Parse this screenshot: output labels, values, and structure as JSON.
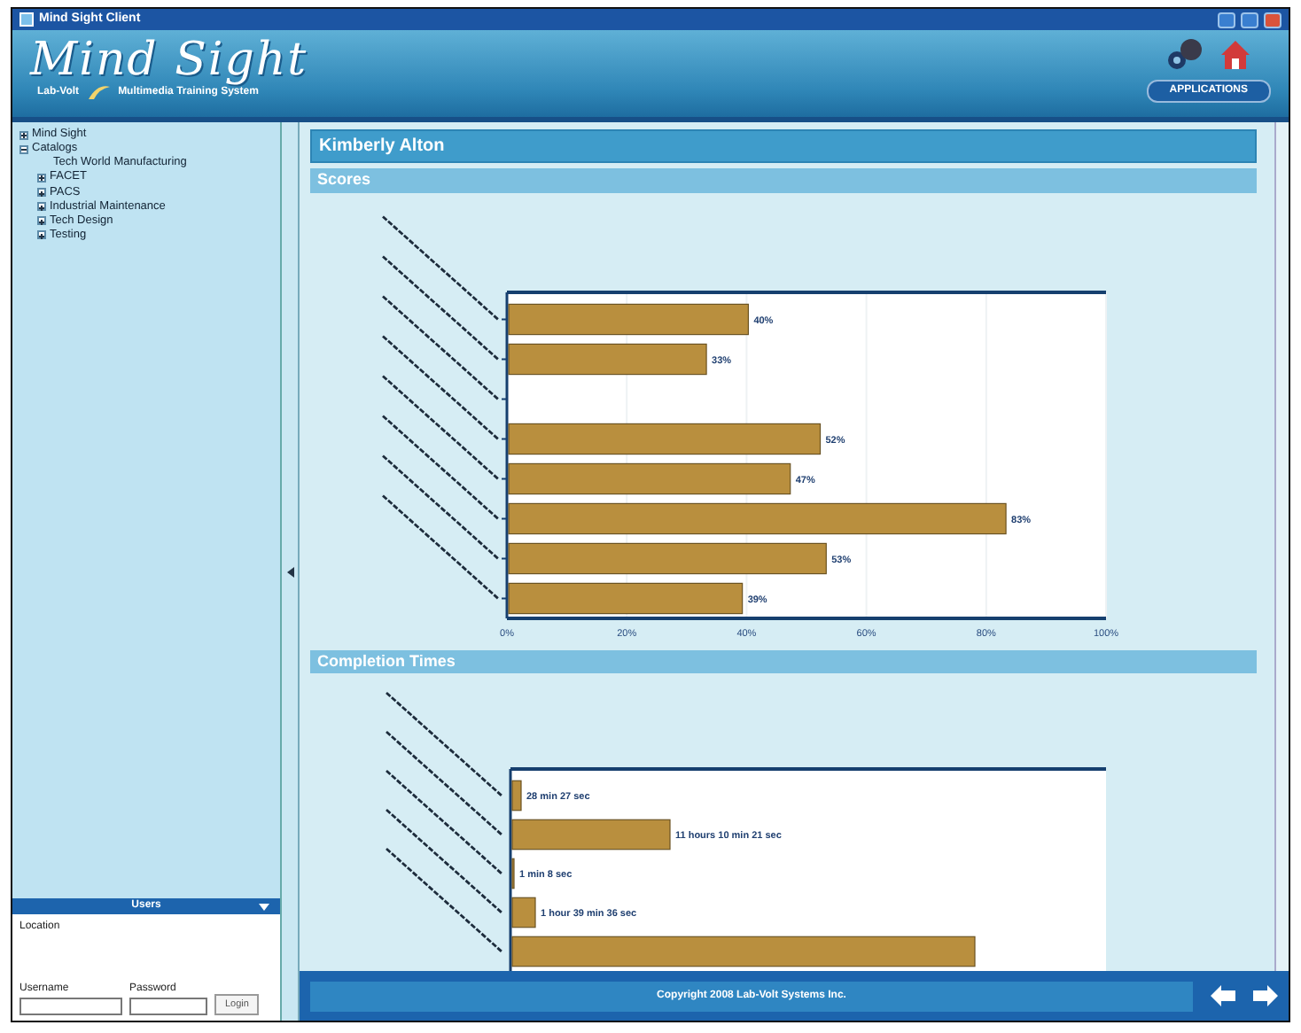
{
  "window": {
    "title": "Mind Sight Client"
  },
  "banner": {
    "logo": "Mind Sight",
    "subtitle_left": "Lab-Volt",
    "subtitle_right": "Multimedia Training System",
    "applications_label": "APPLICATIONS"
  },
  "tree": [
    {
      "label": "Mind Sight",
      "expanded": false
    },
    {
      "label": "Catalogs",
      "expanded": true,
      "children": [
        {
          "label": "Tech World Manufacturing"
        },
        {
          "label": "FACET",
          "expanded": false
        },
        {
          "label": "PACS",
          "expanded": false
        },
        {
          "label": "Industrial Maintenance",
          "expanded": false
        },
        {
          "label": "Tech Design",
          "expanded": false
        },
        {
          "label": "Testing",
          "expanded": false
        }
      ]
    }
  ],
  "users_panel": {
    "title": "Users",
    "location_label": "Location",
    "username_label": "Username",
    "password_label": "Password",
    "login_button": "Login"
  },
  "student_name": "Kimberly Alton",
  "sections": [
    {
      "title": "Scores",
      "chart_data": {
        "type": "bar",
        "orientation": "horizontal",
        "grid": true,
        "xlim": [
          0,
          100
        ],
        "values": [
          40,
          33,
          null,
          52,
          47,
          83,
          53,
          39
        ],
        "value_labels": [
          "40%",
          "33%",
          null,
          "52%",
          "47%",
          "83%",
          "53%",
          "39%"
        ],
        "xticks": [
          {
            "value": 0,
            "label": "0%"
          },
          {
            "value": 20,
            "label": "20%"
          },
          {
            "value": 40,
            "label": "40%"
          },
          {
            "value": 60,
            "label": "60%"
          },
          {
            "value": 80,
            "label": "80%"
          },
          {
            "value": 100,
            "label": "100%"
          }
        ]
      }
    },
    {
      "title": "Completion Times",
      "bar_labels": [
        "28 min 27 sec",
        "11 hours 10 min 21 sec",
        "1 min 8 sec",
        "1 hour 39 min 36 sec"
      ]
    }
  ],
  "footer": "Copyright 2008 Lab-Volt Systems Inc."
}
